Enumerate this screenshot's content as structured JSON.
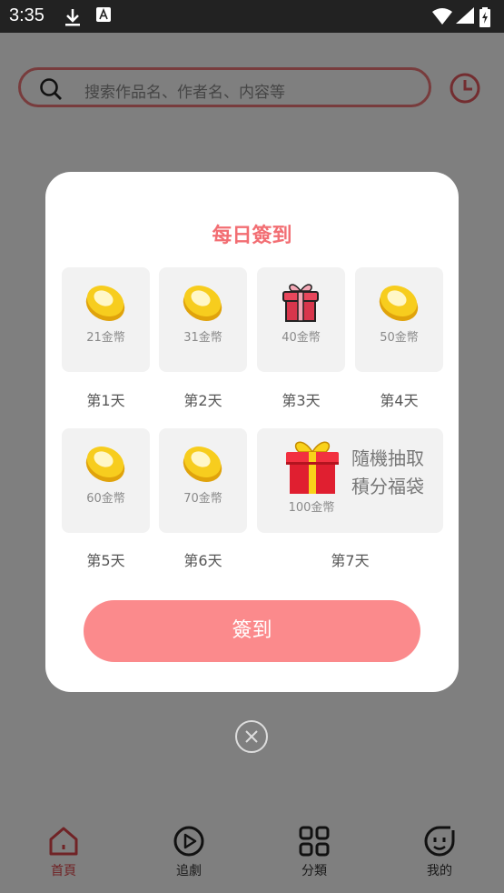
{
  "status_bar": {
    "time": "3:35"
  },
  "search": {
    "placeholder": "搜索作品名、作者名、内容等"
  },
  "dialog": {
    "title": "每日簽到",
    "days": [
      {
        "amount": "21金幣",
        "label": "第1天",
        "icon": "coin-icon"
      },
      {
        "amount": "31金幣",
        "label": "第2天",
        "icon": "coin-icon"
      },
      {
        "amount": "40金幣",
        "label": "第3天",
        "icon": "gift-icon"
      },
      {
        "amount": "50金幣",
        "label": "第4天",
        "icon": "coin-icon"
      },
      {
        "amount": "60金幣",
        "label": "第5天",
        "icon": "coin-icon"
      },
      {
        "amount": "70金幣",
        "label": "第6天",
        "icon": "coin-icon"
      }
    ],
    "day7": {
      "amount": "100金幣",
      "label": "第7天",
      "desc_line1": "隨機抽取",
      "desc_line2": "積分福袋",
      "icon": "big-gift-icon"
    },
    "button_label": "簽到"
  },
  "tabbar": {
    "items": [
      {
        "label": "首頁",
        "icon": "home-icon",
        "active": true
      },
      {
        "label": "追劇",
        "icon": "play-icon",
        "active": false
      },
      {
        "label": "分類",
        "icon": "grid-icon",
        "active": false
      },
      {
        "label": "我的",
        "icon": "face-icon",
        "active": false
      }
    ]
  },
  "colors": {
    "accent": "#f26e73",
    "button": "#fb8a8c",
    "coin": "#f2c318",
    "gift": "#e8324a"
  }
}
